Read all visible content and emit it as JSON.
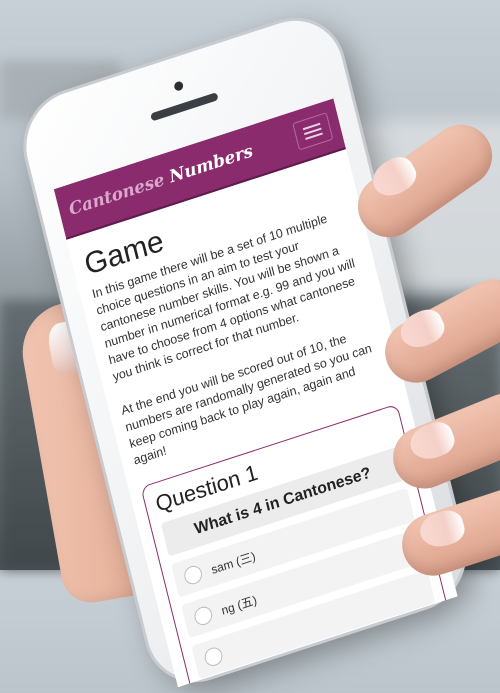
{
  "app": {
    "brand_part1": "Cantonese",
    "brand_part2": "Numbers"
  },
  "page": {
    "title": "Game",
    "intro": "In this game there will be a set of 10 multiple choice questions in an aim to test your cantonese number skills. You will be shown a number in numerical format e.g. 99 and you will have to choose from 4 options what cantonese you think is correct for that number.",
    "outro": "At the end you will be scored out of 10, the numbers are randomally generated so you can keep coming back to play again, again and again!"
  },
  "quiz": {
    "question_heading": "Question 1",
    "question_text": "What is 4 in Cantonese?",
    "options": [
      {
        "label": "sam (三)"
      },
      {
        "label": "ng (五)"
      }
    ]
  },
  "colors": {
    "header_bg": "#8a2b6d",
    "accent": "#8a2b6d"
  },
  "icons": {
    "menu": "hamburger-icon"
  }
}
